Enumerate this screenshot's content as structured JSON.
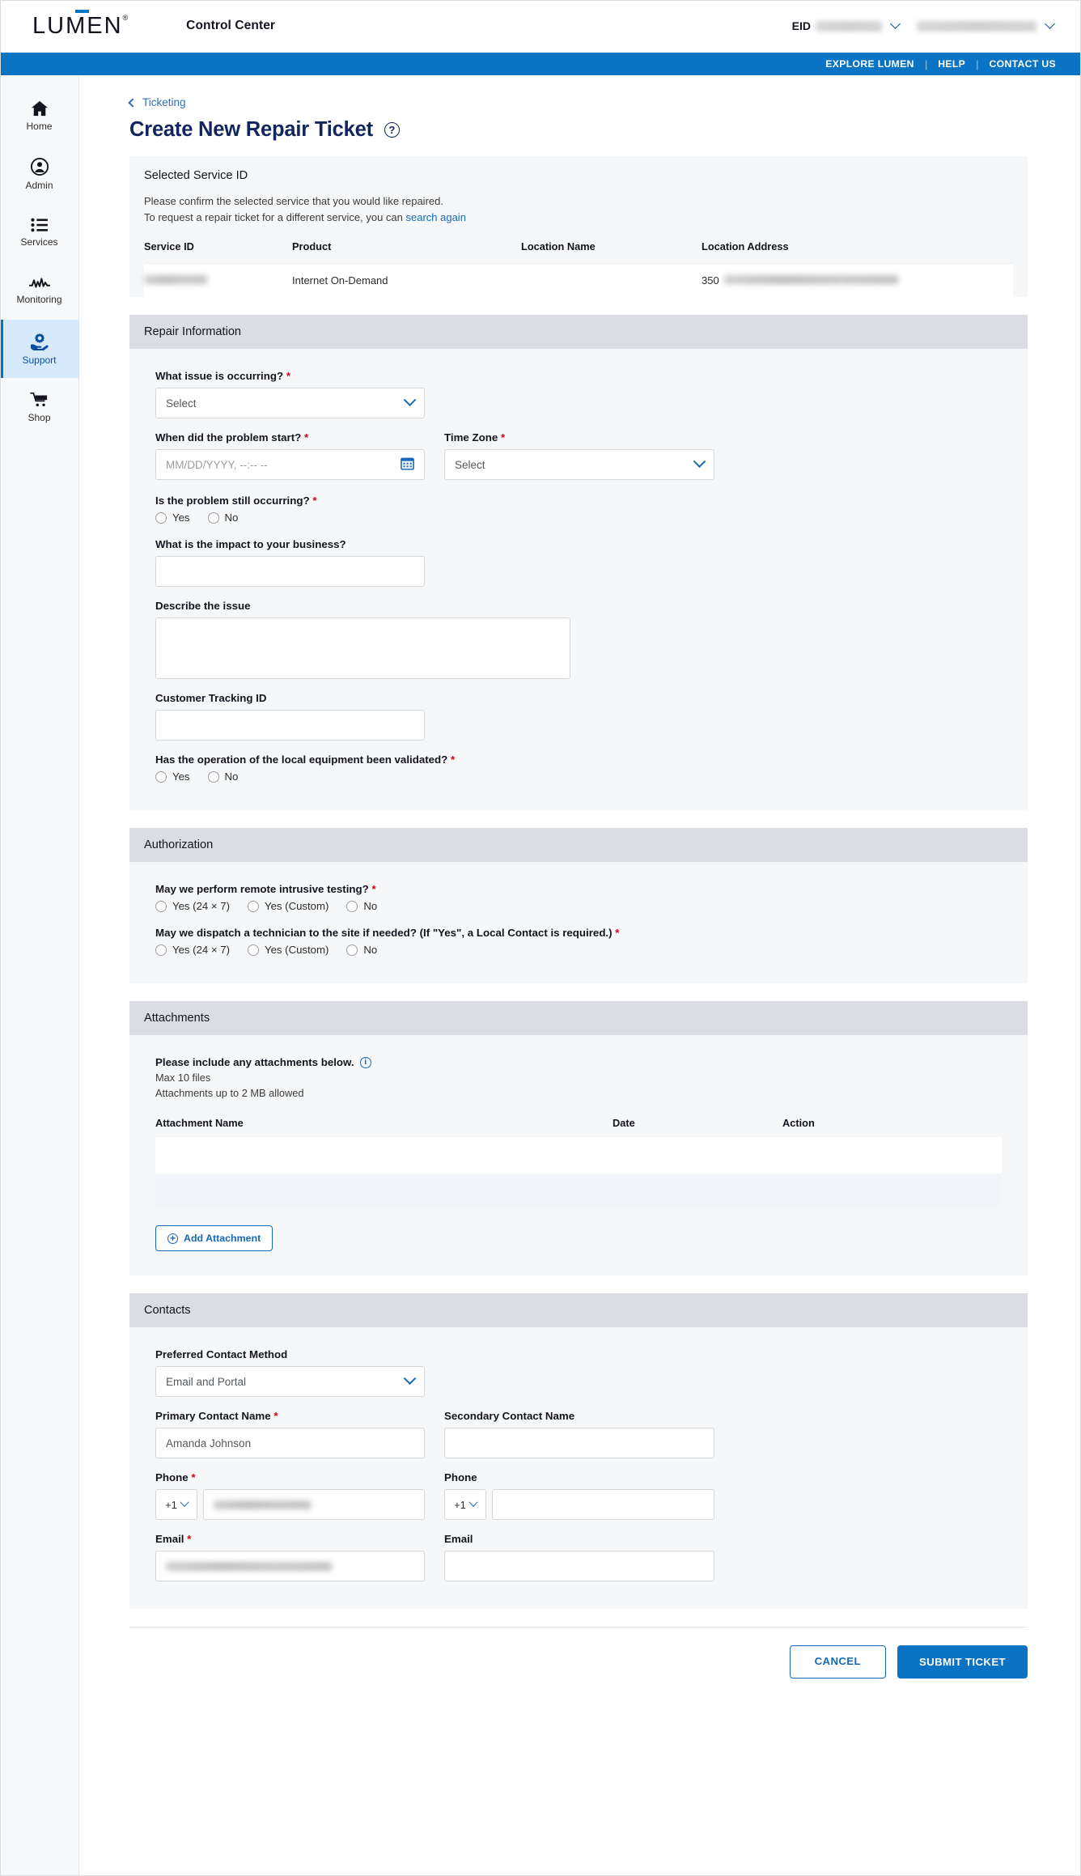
{
  "header": {
    "brand": "LUMEN",
    "brand_reg": "®",
    "app_title": "Control Center",
    "eid_label": "EID",
    "eid_value": "",
    "account_value": ""
  },
  "topnav": {
    "links": [
      "EXPLORE LUMEN",
      "HELP",
      "CONTACT US"
    ],
    "separator": "|",
    "bg_color": "#0a73c4"
  },
  "sidebar": {
    "items": [
      {
        "label": "Home",
        "icon": "home-icon",
        "active": false
      },
      {
        "label": "Admin",
        "icon": "user-circle-icon",
        "active": false
      },
      {
        "label": "Services",
        "icon": "list-icon",
        "active": false
      },
      {
        "label": "Monitoring",
        "icon": "pulse-icon",
        "active": false
      },
      {
        "label": "Support",
        "icon": "support-hand-gear-icon",
        "active": true
      },
      {
        "label": "Shop",
        "icon": "cart-icon",
        "active": false
      }
    ],
    "active_color": "#d6eafc",
    "active_text_color": "#0b4fa0"
  },
  "page": {
    "breadcrumb": "Ticketing",
    "title": "Create New Repair Ticket",
    "help_glyph": "?"
  },
  "service_section": {
    "heading": "Selected Service ID",
    "note_line1": "Please confirm the selected service that you would like repaired.",
    "note_line2_prefix": "To request a repair ticket for a different service, you can ",
    "note_link": "search again",
    "columns": [
      "Service ID",
      "Product",
      "Location Name",
      "Location Address"
    ],
    "row": {
      "service_id": "",
      "product": "Internet On-Demand",
      "location_name": "",
      "location_address_visible": "350",
      "location_address_redacted": ""
    }
  },
  "repair_section": {
    "heading": "Repair Information",
    "issue": {
      "label": "What issue is occurring?",
      "required": true,
      "value": "Select"
    },
    "problem_start": {
      "label": "When did the problem start?",
      "required": true,
      "placeholder": "MM/DD/YYYY, --:-- --",
      "value": ""
    },
    "time_zone": {
      "label": "Time Zone",
      "required": true,
      "value": "Select"
    },
    "still_occurring": {
      "label": "Is the problem still occurring?",
      "required": true,
      "options": [
        "Yes",
        "No"
      ],
      "selected": ""
    },
    "impact": {
      "label": "What is the impact to your business?",
      "required": false,
      "value": ""
    },
    "describe": {
      "label": "Describe the issue",
      "required": false,
      "value": ""
    },
    "tracking_id": {
      "label": "Customer Tracking ID",
      "required": false,
      "value": ""
    },
    "equipment_validated": {
      "label": "Has the operation of the local equipment been validated?",
      "required": true,
      "options": [
        "Yes",
        "No"
      ],
      "selected": ""
    }
  },
  "authorization_section": {
    "heading": "Authorization",
    "questions": [
      {
        "label": "May we perform remote intrusive testing?",
        "required": true,
        "options": [
          "Yes (24 × 7)",
          "Yes (Custom)",
          "No"
        ],
        "selected": ""
      },
      {
        "label": "May we dispatch a technician to the site if needed? (If \"Yes\", a Local Contact is required.)",
        "required": true,
        "options": [
          "Yes (24 × 7)",
          "Yes (Custom)",
          "No"
        ],
        "selected": ""
      }
    ]
  },
  "attachments_section": {
    "heading": "Attachments",
    "lead": "Please include any attachments below.",
    "info_glyph": "i",
    "sub1": "Max 10 files",
    "sub2": "Attachments up to 2 MB allowed",
    "columns": [
      "Attachment Name",
      "Date",
      "Action"
    ],
    "rows": [],
    "add_button": "Add Attachment",
    "add_icon": "plus-circle-icon"
  },
  "contacts_section": {
    "heading": "Contacts",
    "preferred_method": {
      "label": "Preferred Contact Method",
      "required": false,
      "value": "Email and Portal"
    },
    "primary_name": {
      "label": "Primary Contact Name",
      "required": true,
      "value": "Amanda Johnson"
    },
    "secondary_name": {
      "label": "Secondary Contact Name",
      "required": false,
      "value": ""
    },
    "primary_phone": {
      "label": "Phone",
      "required": true,
      "country_code": "+1",
      "value": ""
    },
    "secondary_phone": {
      "label": "Phone",
      "required": false,
      "country_code": "+1",
      "value": ""
    },
    "primary_email": {
      "label": "Email",
      "required": true,
      "value": ""
    },
    "secondary_email": {
      "label": "Email",
      "required": false,
      "value": ""
    }
  },
  "footer": {
    "cancel_label": "CANCEL",
    "submit_label": "SUBMIT TICKET",
    "submit_color": "#0a73c4"
  }
}
